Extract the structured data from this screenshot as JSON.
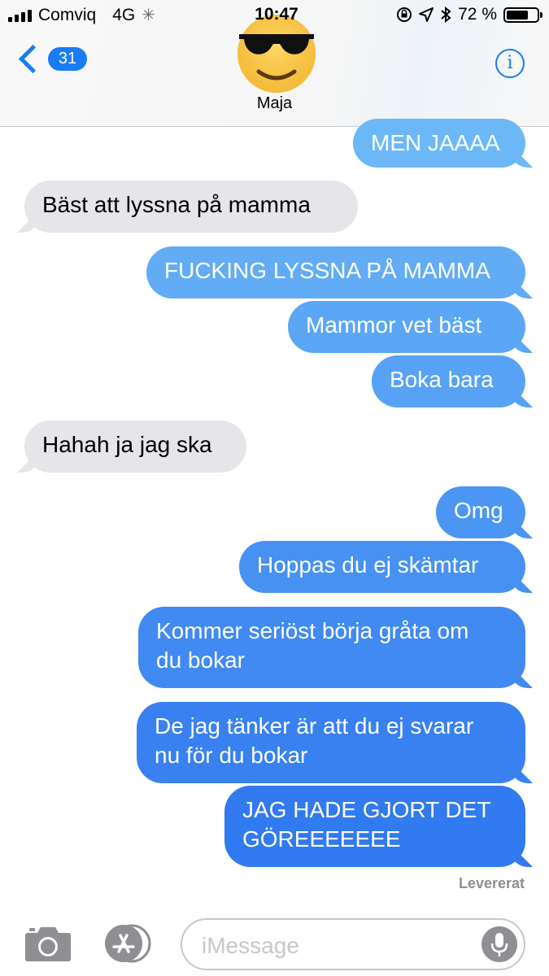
{
  "status_bar": {
    "carrier": "Comviq",
    "network": "4G",
    "time": "10:47",
    "battery_text": "72 %",
    "battery_level": 0.72
  },
  "header": {
    "back_count": "31",
    "contact_name": "Maja",
    "avatar_icon": "sunglasses-emoji-icon",
    "info_label": "i"
  },
  "colors": {
    "accent": "#1a7cf5",
    "sent_top": "#6cb8f7",
    "sent_bottom": "#2a72ee",
    "received": "#e5e5ea"
  },
  "messages": [
    {
      "from": "me",
      "text": "MEN JAAAA"
    },
    {
      "from": "them",
      "text": "Bäst att lyssna på mamma"
    },
    {
      "from": "me",
      "text": "FUCKING LYSSNA PÅ MAMMA"
    },
    {
      "from": "me",
      "text": "Mammor vet bäst"
    },
    {
      "from": "me",
      "text": "Boka bara"
    },
    {
      "from": "them",
      "text": "Hahah ja jag ska"
    },
    {
      "from": "me",
      "text": "Omg"
    },
    {
      "from": "me",
      "text": "Hoppas du ej skämtar"
    },
    {
      "from": "me",
      "text": "Kommer seriöst börja gråta om\ndu bokar"
    },
    {
      "from": "me",
      "text": "De jag tänker är att du ej svarar\nnu för du bokar"
    },
    {
      "from": "me",
      "text": "JAG HADE GJORT DET\nGÖREEEEEEE"
    }
  ],
  "delivered_label": "Levererat",
  "compose": {
    "placeholder": "iMessage",
    "camera_icon": "camera-icon",
    "apps_icon": "app-store-icon",
    "mic_icon": "microphone-icon"
  }
}
